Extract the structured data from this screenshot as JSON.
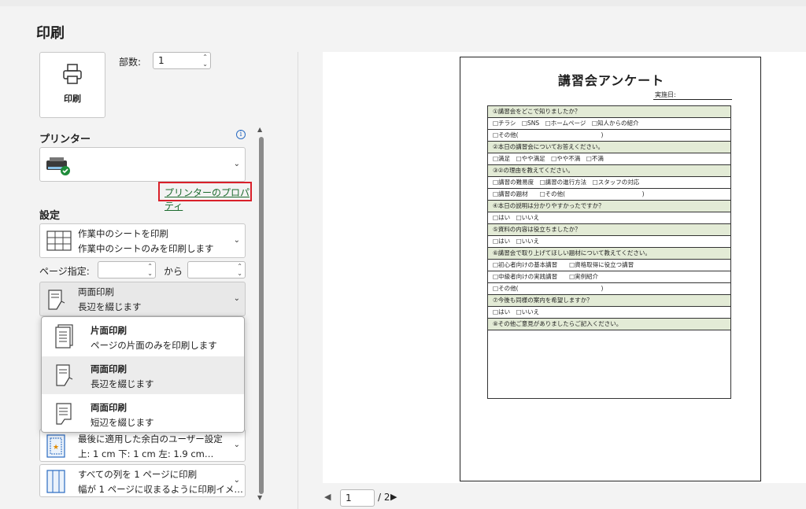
{
  "page": {
    "title": "印刷"
  },
  "print_button": {
    "label": "印刷"
  },
  "copies": {
    "label": "部数:",
    "value": "1"
  },
  "printer": {
    "heading": "プリンター",
    "info_icon": "i",
    "properties_link": "プリンターのプロパティ"
  },
  "settings": {
    "heading": "設定",
    "print_what": {
      "title": "作業中のシートを印刷",
      "desc": "作業中のシートのみを印刷します"
    },
    "pages": {
      "label": "ページ指定:",
      "from_label": "から"
    },
    "duplex": {
      "title": "両面印刷",
      "desc": "長辺を綴じます"
    },
    "margins": {
      "title": "最後に適用した余白のユーザー設定",
      "desc": "上: 1 cm 下: 1 cm 左: 1.9 cm…"
    },
    "scaling": {
      "title": "すべての列を 1 ページに印刷",
      "desc": "幅が 1 ページに収まるように印刷イメ…"
    }
  },
  "duplex_dropdown": {
    "items": [
      {
        "title": "片面印刷",
        "desc": "ページの片面のみを印刷します",
        "icon": "single-sided-icon"
      },
      {
        "title": "両面印刷",
        "desc": "長辺を綴じます",
        "icon": "duplex-long-edge-icon",
        "selected": true
      },
      {
        "title": "両面印刷",
        "desc": "短辺を綴じます",
        "icon": "duplex-short-edge-icon"
      }
    ]
  },
  "preview": {
    "doc_title": "講習会アンケート",
    "date_label": "実施日:",
    "rows": [
      {
        "text": "①講習会をどこで知りましたか？",
        "header": true
      },
      {
        "text": "□チラシ　□SNS　□ホームページ　□知人からの紹介"
      },
      {
        "text": "□その他(　　　　　　　　　　　　　　)"
      },
      {
        "text": "②本日の講習会についてお答えください。",
        "header": true
      },
      {
        "text": "□満足　□やや満足　□やや不満　□不満"
      },
      {
        "text": "③②の理由を教えてください。",
        "header": true
      },
      {
        "text": "□講習の難易度　□講習の進行方法　□スタッフの対応"
      },
      {
        "text": "□講習の題材　　□その他(　　　　　　　　　　　　　)"
      },
      {
        "text": "④本日の説明は分かりやすかったですか？",
        "header": true
      },
      {
        "text": "□はい　□いいえ"
      },
      {
        "text": "⑤資料の内容は役立ちましたか？",
        "header": true
      },
      {
        "text": "□はい　□いいえ"
      },
      {
        "text": "⑥講習会で取り上げてほしい題材について教えてください。",
        "header": true
      },
      {
        "text": "□初心者向けの基本講習　　□資格取得に役立つ講習"
      },
      {
        "text": "□中級者向けの実践講習　　□実例紹介"
      },
      {
        "text": "□その他(　　　　　　　　　　　　　　)"
      },
      {
        "text": "⑦今後も同様の案内を希望しますか？",
        "header": true
      },
      {
        "text": "□はい　□いいえ"
      },
      {
        "text": "⑧その他ご意見がありましたらご記入ください。",
        "header": true
      }
    ]
  },
  "pager": {
    "current": "1",
    "total": "/ 2"
  }
}
